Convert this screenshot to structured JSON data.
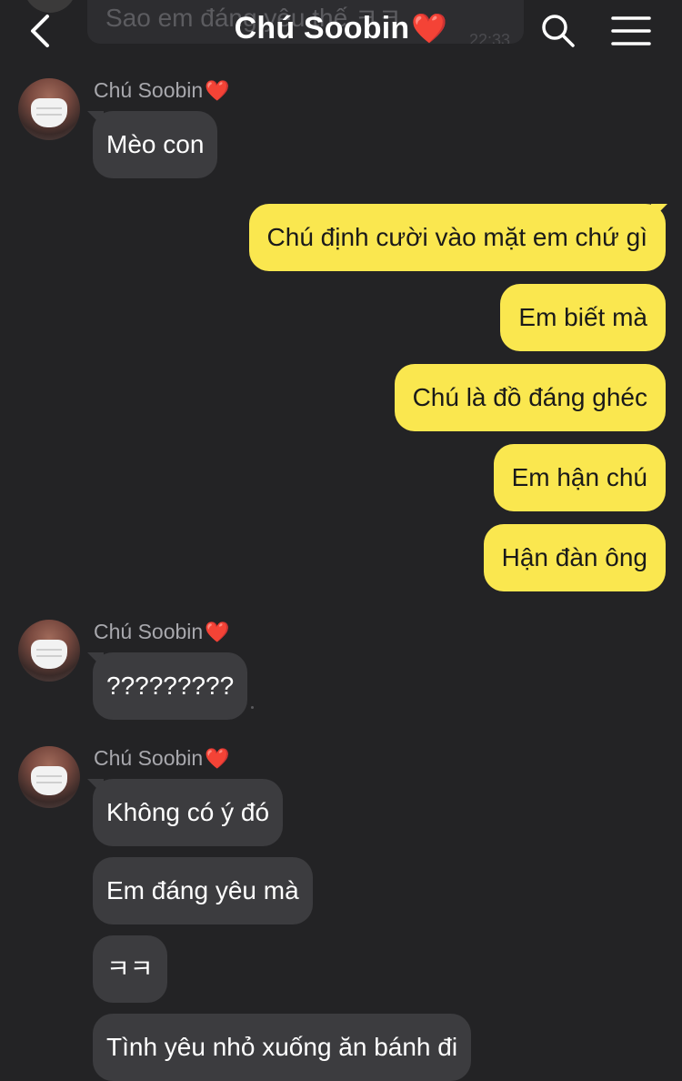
{
  "header": {
    "title": "Chú Soobin",
    "title_heart": "❤️",
    "prev_message_preview": "Sao em đáng yêu thế ㅋㅋ",
    "prev_message_time": "22:33"
  },
  "messages": [
    {
      "type": "in",
      "sender": "Chú Soobin",
      "heart": "❤️",
      "texts": [
        "Mèo con"
      ]
    },
    {
      "type": "out",
      "texts": [
        "Chú định cười vào mặt em chứ gì",
        "Em biết mà",
        "Chú là đồ đáng ghéc",
        "Em hận chú",
        "Hận đàn ông"
      ]
    },
    {
      "type": "in",
      "sender": "Chú Soobin",
      "heart": "❤️",
      "texts": [
        "?????????"
      ]
    },
    {
      "type": "in",
      "sender": "Chú Soobin",
      "heart": "❤️",
      "texts": [
        "Không có ý đó",
        "Em đáng yêu mà",
        "ㅋㅋ",
        "Tình yêu nhỏ xuống ăn bánh đi"
      ]
    }
  ],
  "colors": {
    "background": "#232325",
    "incoming_bubble": "#3c3c3f",
    "outgoing_bubble": "#fae74f",
    "heart": "#e8352f"
  }
}
